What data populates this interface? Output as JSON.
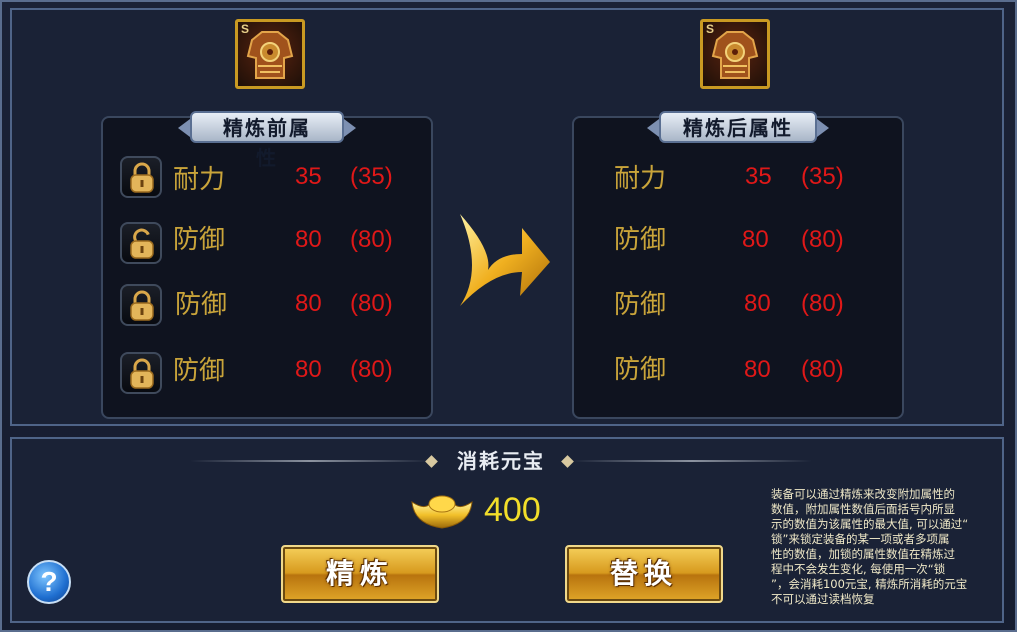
{
  "before_panel": {
    "title": "精炼前属性",
    "rows": [
      {
        "name": "耐力",
        "value": "35",
        "max": "(35)",
        "lock": "locked"
      },
      {
        "name": "防御",
        "value": "80",
        "max": "(80)",
        "lock": "unlocked"
      },
      {
        "name": "防御",
        "value": "80",
        "max": "(80)",
        "lock": "locked"
      },
      {
        "name": "防御",
        "value": "80",
        "max": "(80)",
        "lock": "locked"
      }
    ]
  },
  "after_panel": {
    "title": "精炼后属性",
    "rows": [
      {
        "name": "耐力",
        "value": "35",
        "max": "(35)"
      },
      {
        "name": "防御",
        "value": "80",
        "max": "(80)"
      },
      {
        "name": "防御",
        "value": "80",
        "max": "(80)"
      },
      {
        "name": "防御",
        "value": "80",
        "max": "(80)"
      }
    ]
  },
  "equipment": {
    "grade": "S",
    "icon": "armor-icon"
  },
  "cost": {
    "title": "消耗元宝",
    "amount": "400",
    "currency_icon": "gold-ingot-icon"
  },
  "buttons": {
    "refine": "精炼",
    "replace": "替换",
    "help": "?"
  },
  "info_text": "装备可以通过精炼来改变附加属性的\n数值，附加属性数值后面括号内所显\n示的数值为该属性的最大值, 可以通过“\n锁”来锁定装备的某一项或者多项属\n性的数值，加锁的属性数值在精炼过\n程中不会发生变化, 每使用一次“锁\n”，会消耗100元宝, 精炼所消耗的元宝\n不可以通过读档恢复",
  "colors": {
    "attr_name": "#c9a43a",
    "attr_value": "#e01818",
    "cost_amount": "#f2de2a",
    "button_gold": "#d79a1e"
  }
}
